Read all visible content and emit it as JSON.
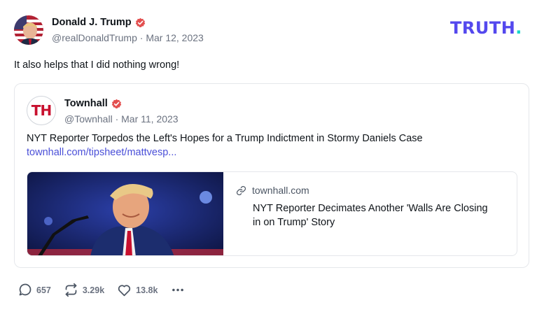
{
  "post": {
    "author": {
      "name": "Donald J. Trump",
      "handle": "@realDonaldTrump",
      "date": "Mar 12, 2023",
      "verified": true
    },
    "text": "It also helps that I did nothing wrong!",
    "logo": {
      "text": "TRUTH",
      "dot": "."
    }
  },
  "quote": {
    "author": {
      "name": "Townhall",
      "avatar_text": "TH",
      "handle": "@Townhall",
      "date": "Mar 11, 2023",
      "verified": true
    },
    "text": "NYT Reporter Torpedos the Left's Hopes for a Trump Indictment in Stormy Daniels Case",
    "link": "townhall.com/tipsheet/mattvesp...",
    "link_card": {
      "domain": "townhall.com",
      "title": "NYT Reporter Decimates Another 'Walls Are Closing in on Trump' Story",
      "image_icon": "news-photo-thumbnail"
    }
  },
  "actions": {
    "replies": "657",
    "retruths": "3.29k",
    "likes": "13.8k",
    "more_icon": "more-dots-icon"
  },
  "colors": {
    "brand": "#5448ee",
    "brand_accent": "#17d6c9",
    "verified": "#e34f4f",
    "link": "#4a4fd8",
    "muted": "#6b7280"
  }
}
